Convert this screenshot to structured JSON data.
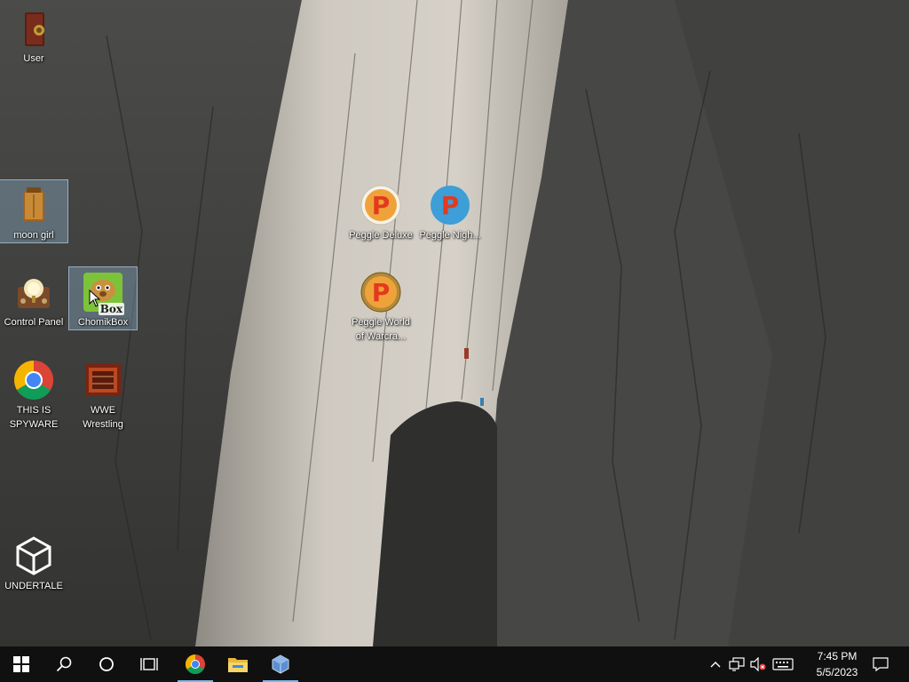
{
  "desktop": {
    "icons": [
      {
        "label": "User",
        "icon": "user-folder-icon"
      },
      {
        "label": "moon girl",
        "icon": "cabinet-icon",
        "selected": true
      },
      {
        "label": "Control Panel",
        "icon": "control-panel-icon"
      },
      {
        "label": "ChomikBox",
        "icon": "chomikbox-icon",
        "selected": true,
        "badge": "Box"
      },
      {
        "label": "THIS IS SPYWARE",
        "icon": "chrome-icon"
      },
      {
        "label": "WWE Wrestling",
        "icon": "wwe-game-icon"
      },
      {
        "label": "UNDERTALE",
        "icon": "unity-icon"
      },
      {
        "label": "Peggle Deluxe",
        "icon": "peggle-icon",
        "glyph": "P"
      },
      {
        "label": "Peggle Nigh...",
        "icon": "peggle-nights-icon",
        "glyph": "P"
      },
      {
        "label": "Peggle World of Warcra...",
        "icon": "peggle-wow-icon",
        "glyph": "P"
      }
    ]
  },
  "taskbar": {
    "start": "windows-start-icon",
    "search": "search-icon",
    "cortana": "cortana-circle-icon",
    "taskview": "task-view-icon",
    "pinned": [
      {
        "name": "chrome",
        "icon": "chrome-icon",
        "active": true
      },
      {
        "name": "file-explorer",
        "icon": "folder-icon",
        "active": false
      },
      {
        "name": "virtualbox",
        "icon": "virtualbox-cube-icon",
        "active": true
      }
    ],
    "tray": {
      "chevron": "chevron-up-icon",
      "network": "network-icon",
      "volume": "volume-muted-icon",
      "keyboard": "keyboard-icon"
    },
    "clock": {
      "time": "7:45 PM",
      "date": "5/5/2023"
    },
    "notifications": "action-center-icon"
  },
  "colors": {
    "taskbar": "#101010",
    "accent": "#76b9ed",
    "selection": "#96bedc"
  }
}
